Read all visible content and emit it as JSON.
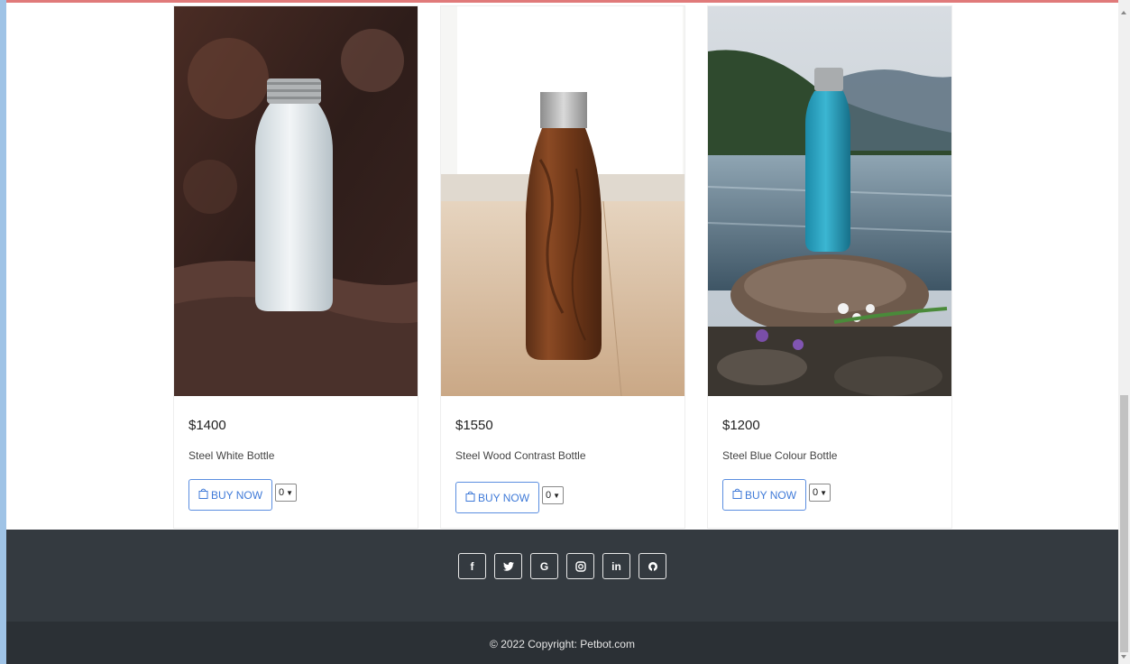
{
  "products": [
    {
      "price": "$1400",
      "name": "Steel White Bottle",
      "buy_label": "BUY NOW",
      "qty": "0",
      "image": "white-bottle-photo"
    },
    {
      "price": "$1550",
      "name": "Steel Wood Contrast Bottle",
      "buy_label": "BUY NOW",
      "qty": "0",
      "image": "wood-bottle-photo"
    },
    {
      "price": "$1200",
      "name": "Steel Blue Colour Bottle",
      "buy_label": "BUY NOW",
      "qty": "0",
      "image": "blue-bottle-photo"
    }
  ],
  "footer": {
    "social": [
      {
        "icon": "facebook-icon",
        "glyph": "f"
      },
      {
        "icon": "twitter-icon",
        "glyph": "🐦"
      },
      {
        "icon": "google-icon",
        "glyph": "G"
      },
      {
        "icon": "instagram-icon",
        "glyph": "◎"
      },
      {
        "icon": "linkedin-icon",
        "glyph": "in"
      },
      {
        "icon": "github-icon",
        "glyph": "◉"
      }
    ],
    "copyright": "© 2022 Copyright: Petbot.com"
  },
  "colors": {
    "accent": "#3f7ad8",
    "footer_top": "#343a40",
    "footer_bottom": "#2b3035"
  }
}
